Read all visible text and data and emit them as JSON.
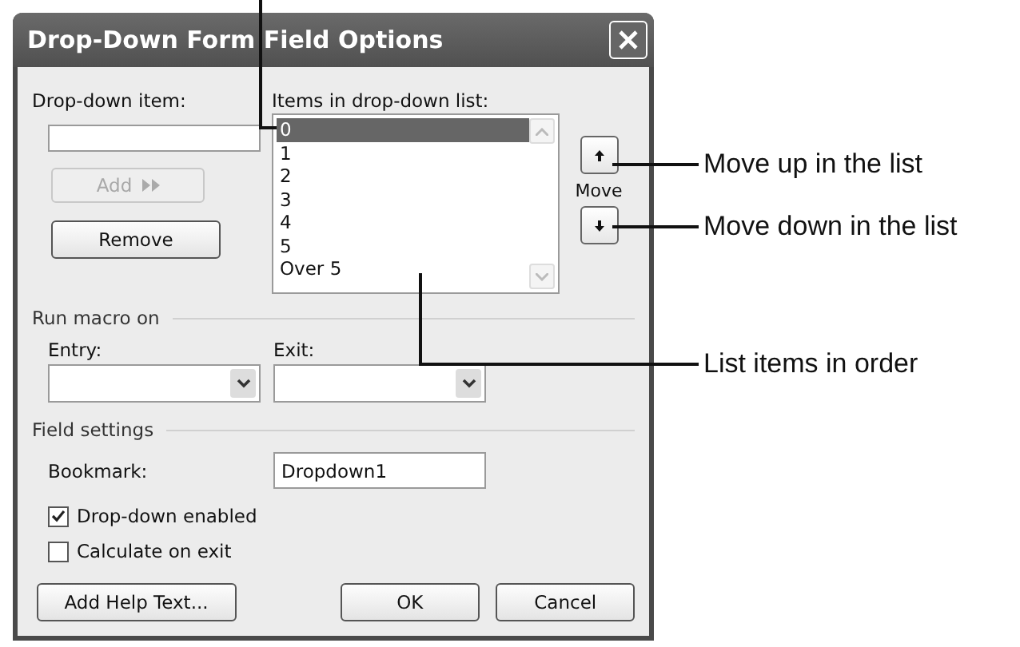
{
  "window": {
    "title": "Drop-Down Form Field Options"
  },
  "drop_down_item": {
    "label": "Drop-down item:"
  },
  "add_button": {
    "label": "Add",
    "disabled": true
  },
  "remove_button": {
    "label": "Remove",
    "disabled": false
  },
  "items_list": {
    "label": "Items in drop-down list:",
    "items": [
      {
        "text": "0",
        "selected": true
      },
      {
        "text": "1",
        "selected": false
      },
      {
        "text": "2",
        "selected": false
      },
      {
        "text": "3",
        "selected": false
      },
      {
        "text": "4",
        "selected": false
      },
      {
        "text": "5",
        "selected": false
      },
      {
        "text": "Over 5",
        "selected": false
      }
    ]
  },
  "move": {
    "label": "Move"
  },
  "run_macro": {
    "heading": "Run macro on",
    "entry": {
      "label": "Entry:"
    },
    "exit": {
      "label": "Exit:"
    }
  },
  "field_settings": {
    "heading": "Field settings",
    "bookmark": {
      "label": "Bookmark:",
      "value": "Dropdown1"
    },
    "checkboxes": [
      {
        "label": "Drop-down enabled",
        "checked": true
      },
      {
        "label": "Calculate on exit",
        "checked": false
      }
    ]
  },
  "buttons": [
    {
      "label": "Add Help Text..."
    },
    {
      "label": "OK"
    },
    {
      "label": "Cancel"
    }
  ],
  "callouts": [
    {
      "text": "Move up in the list"
    },
    {
      "text": "Move down in the list"
    },
    {
      "text": "List items in order"
    }
  ]
}
